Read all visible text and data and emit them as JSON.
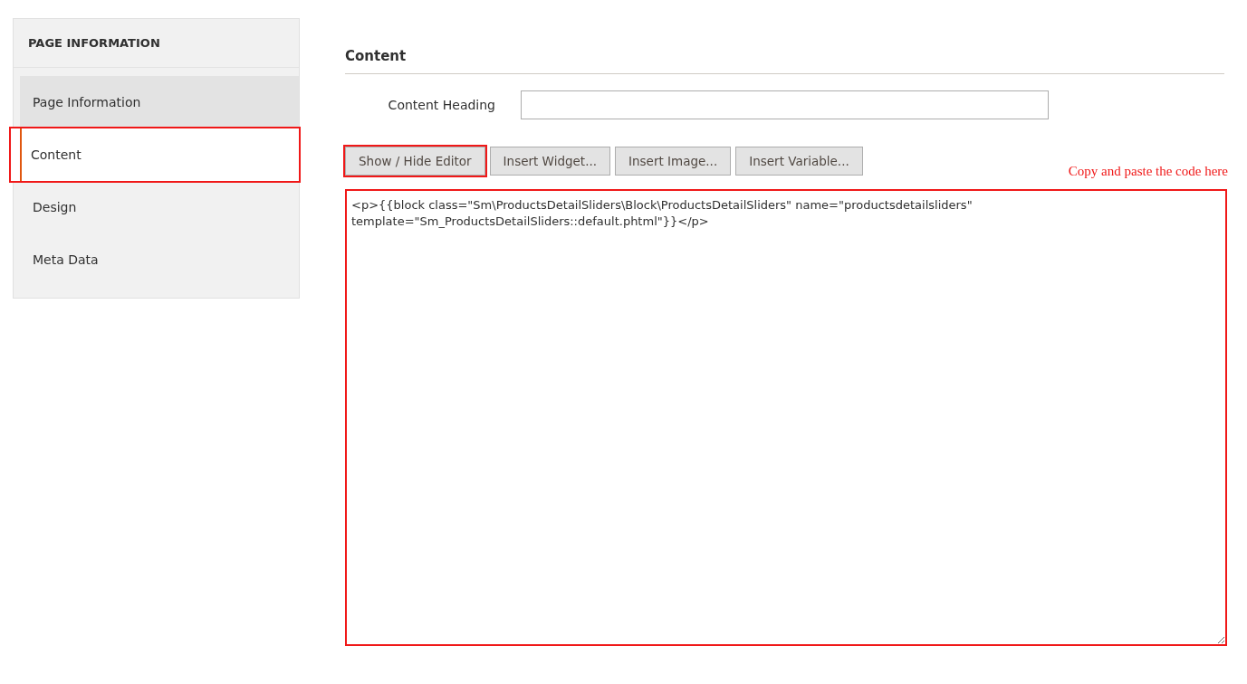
{
  "sidebar": {
    "title": "PAGE INFORMATION",
    "items": [
      {
        "label": "Page Information",
        "selected": false,
        "highlighted": false,
        "hovered": true
      },
      {
        "label": "Content",
        "selected": true,
        "highlighted": true,
        "hovered": false
      },
      {
        "label": "Design",
        "selected": false,
        "highlighted": false,
        "hovered": false
      },
      {
        "label": "Meta Data",
        "selected": false,
        "highlighted": false,
        "hovered": false
      }
    ]
  },
  "section": {
    "title": "Content",
    "heading_field": {
      "label": "Content Heading"
    },
    "buttons": [
      {
        "label": "Show / Hide Editor",
        "highlighted": true
      },
      {
        "label": "Insert Widget...",
        "highlighted": false
      },
      {
        "label": "Insert Image...",
        "highlighted": false
      },
      {
        "label": "Insert Variable...",
        "highlighted": false
      }
    ],
    "annotation": "Copy and paste the code here",
    "editor": {
      "value": "<p>{{block class=\"Sm\\ProductsDetailSliders\\Block\\ProductsDetailSliders\" name=\"productsdetailsliders\" template=\"Sm_ProductsDetailSliders::default.phtml\"}}</p>",
      "highlighted": true
    }
  }
}
